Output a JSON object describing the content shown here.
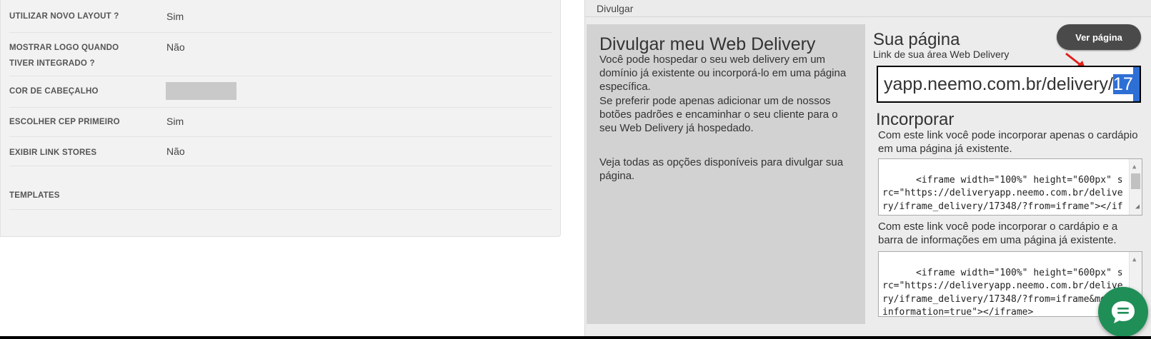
{
  "settings": {
    "rows": [
      {
        "label": "UTILIZAR NOVO LAYOUT ?",
        "value": "Sim"
      },
      {
        "label": "MOSTRAR LOGO QUANDO TIVER INTEGRADO ?",
        "value": "Não"
      },
      {
        "label": "COR DE CABEÇALHO",
        "value": ""
      },
      {
        "label": "ESCOLHER CEP PRIMEIRO",
        "value": "Sim"
      },
      {
        "label": "EXIBIR LINK STORES",
        "value": "Não"
      },
      {
        "label": "TEMPLATES",
        "value": ""
      }
    ],
    "header_color": "#c9c9c9"
  },
  "divulgar": {
    "header": "Divulgar",
    "title": "Divulgar meu Web Delivery",
    "paragraph1": "Você pode hospedar o seu web delivery em um domínio já existente ou incorporá-lo em uma página específica.",
    "paragraph2": "Se preferir pode apenas adicionar um de nossos botões padrões e encaminhar o seu cliente para o seu Web Delivery já hospedado.",
    "paragraph3": "Veja todas as opções disponíveis para divulgar sua página."
  },
  "sua_pagina": {
    "title": "Sua página",
    "subtitle": "Link de sua área Web Delivery",
    "ver_button": "Ver página",
    "url_visible": "yapp.neemo.com.br/delivery/",
    "url_selected": "17"
  },
  "incorporar": {
    "title": "Incorporar",
    "text1": "Com este link você pode incorporar apenas o cardápio em uma página já existente.",
    "code1": "<iframe width=\"100%\" height=\"600px\" src=\"https://deliveryapp.neemo.com.br/delivery/iframe_delivery/17348/?from=iframe\"></iframe>",
    "text2": "Com este link você pode incorporar o cardápio e a barra de informações em uma página já existente.",
    "code2": "<iframe width=\"100%\" height=\"600px\" src=\"https://deliveryapp.neemo.com.br/delivery/iframe_delivery/17348/?from=iframe&more_information=true\"></iframe>"
  },
  "colors": {
    "accent_dark": "#4a4a4a",
    "chat_green": "#1f8f57",
    "selection_blue": "#2e6fd6",
    "arrow_red": "#e0201c"
  }
}
